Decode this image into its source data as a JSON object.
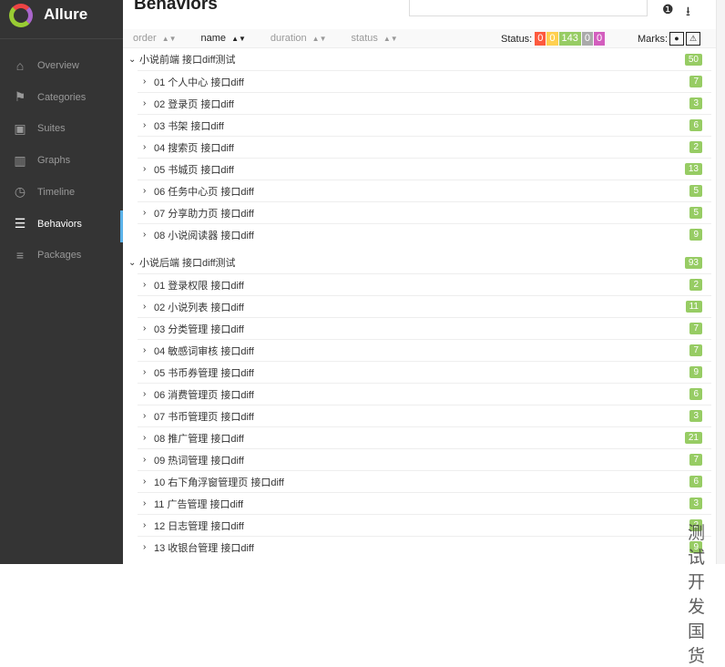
{
  "app": {
    "name": "Allure"
  },
  "sidebar": {
    "items": [
      {
        "label": "Overview",
        "icon": "home-icon"
      },
      {
        "label": "Categories",
        "icon": "flag-icon"
      },
      {
        "label": "Suites",
        "icon": "briefcase-icon"
      },
      {
        "label": "Graphs",
        "icon": "bar-chart-icon"
      },
      {
        "label": "Timeline",
        "icon": "clock-icon"
      },
      {
        "label": "Behaviors",
        "icon": "list-icon",
        "active": true
      },
      {
        "label": "Packages",
        "icon": "align-left-icon"
      }
    ]
  },
  "header": {
    "title": "Behaviors",
    "search_value": ""
  },
  "toolbar": {
    "sorts": [
      "order",
      "name",
      "duration",
      "status"
    ],
    "status_label": "Status:",
    "status_counts": [
      {
        "v": "0",
        "c": "#fd5a3e"
      },
      {
        "v": "0",
        "c": "#ffd050"
      },
      {
        "v": "143",
        "c": "#97cc64"
      },
      {
        "v": "0",
        "c": "#aaaaaa"
      },
      {
        "v": "0",
        "c": "#d35ebe"
      }
    ],
    "marks_label": "Marks:"
  },
  "groups": [
    {
      "name": "小说前端 接口diff测试",
      "count": "50",
      "items": [
        {
          "name": "01 个人中心 接口diff",
          "count": "7"
        },
        {
          "name": "02 登录页 接口diff",
          "count": "3"
        },
        {
          "name": "03 书架 接口diff",
          "count": "6"
        },
        {
          "name": "04 搜索页 接口diff",
          "count": "2"
        },
        {
          "name": "05 书城页 接口diff",
          "count": "13"
        },
        {
          "name": "06 任务中心页 接口diff",
          "count": "5"
        },
        {
          "name": "07 分享助力页 接口diff",
          "count": "5"
        },
        {
          "name": "08 小说阅读器 接口diff",
          "count": "9"
        }
      ]
    },
    {
      "name": "小说后端 接口diff测试",
      "count": "93",
      "items": [
        {
          "name": "01 登录权限 接口diff",
          "count": "2"
        },
        {
          "name": "02 小说列表 接口diff",
          "count": "11"
        },
        {
          "name": "03 分类管理 接口diff",
          "count": "7"
        },
        {
          "name": "04 敏感词审核 接口diff",
          "count": "7"
        },
        {
          "name": "05 书币券管理 接口diff",
          "count": "9"
        },
        {
          "name": "06 消费管理页 接口diff",
          "count": "6"
        },
        {
          "name": "07 书币管理页 接口diff",
          "count": "3"
        },
        {
          "name": "08 推广管理 接口diff",
          "count": "21"
        },
        {
          "name": "09 热词管理 接口diff",
          "count": "7"
        },
        {
          "name": "10 右下角浮窗管理页 接口diff",
          "count": "6"
        },
        {
          "name": "11 广告管理 接口diff",
          "count": "3"
        },
        {
          "name": "12 日志管理 接口diff",
          "count": "2"
        },
        {
          "name": "13 收银台管理 接口diff",
          "count": "9"
        }
      ]
    }
  ],
  "watermark": "测试开发国货"
}
